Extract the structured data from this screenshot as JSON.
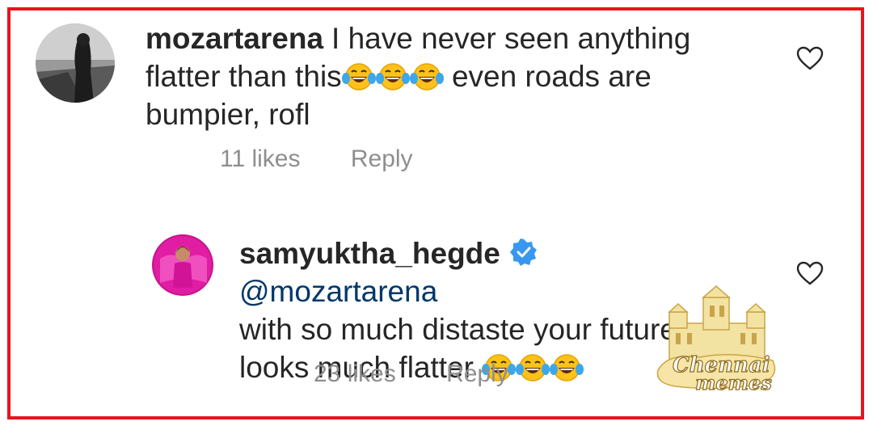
{
  "comments": [
    {
      "username": "mozartarena",
      "text_line1": "I have never seen anything",
      "text_line2a": "flatter than this",
      "text_line2b": " even roads are",
      "text_line3": "bumpier, rofl",
      "likes": "11 likes",
      "reply_label": "Reply",
      "emoji": "face-with-tears-of-joy"
    },
    {
      "username": "samyuktha_hegde",
      "mention": "@mozartarena",
      "text_line2": "with so much distaste your future",
      "text_line3": "looks much flatter ",
      "likes": "23 likes",
      "reply_label": "Reply",
      "verified": true,
      "emoji": "face-with-tears-of-joy"
    }
  ],
  "watermark": {
    "line1": "Chennai",
    "line2": "memes"
  },
  "colors": {
    "border": "#e8141c",
    "text": "#262626",
    "muted": "#8e8e8e",
    "mention": "#00376b",
    "verified": "#3897f0"
  }
}
